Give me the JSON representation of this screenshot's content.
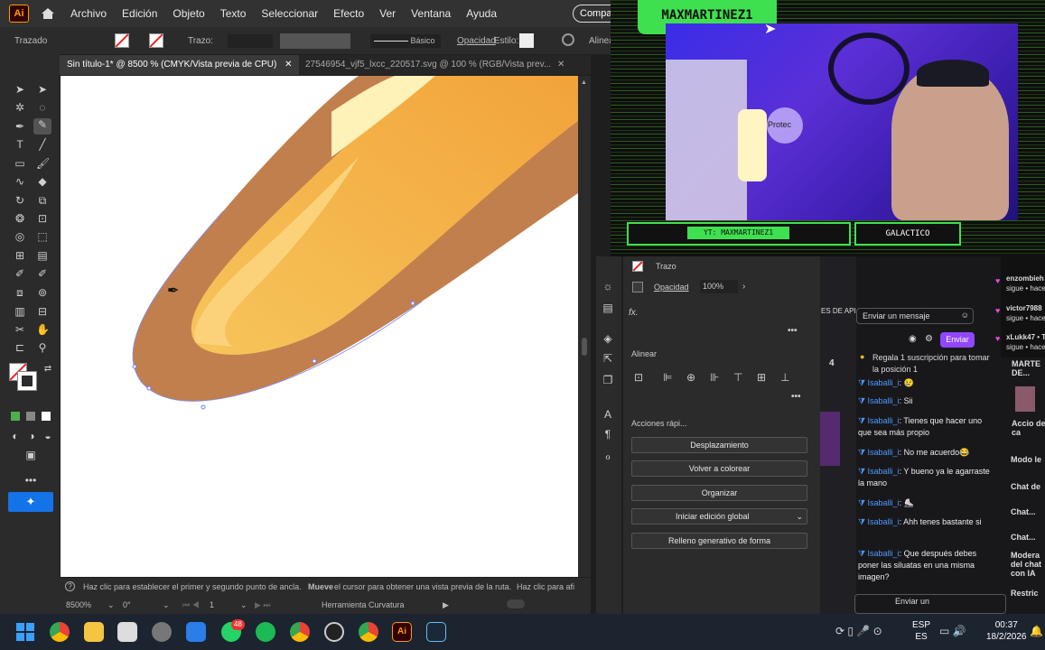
{
  "app": {
    "logo": "Ai"
  },
  "menu": [
    "Archivo",
    "Edición",
    "Objeto",
    "Texto",
    "Seleccionar",
    "Efecto",
    "Ver",
    "Ventana",
    "Ayuda"
  ],
  "share_label": "Compartir",
  "control_bar": {
    "object_label": "Trazado",
    "stroke_label": "Trazo:",
    "basic_label": "Básico",
    "opacity_label": "Opacidad",
    "style_label": "Estilo:",
    "align_label": "Alinea"
  },
  "doc_tabs": [
    {
      "label": "Sin título-1* @ 8500 % (CMYK/Vista previa de CPU)"
    },
    {
      "label": "27546954_vjf5_lxcc_220517.svg @ 100 % (RGB/Vista prev..."
    }
  ],
  "status": {
    "hint_1": "Haz clic para establecer el primer y segundo punto de ancla.",
    "hint_2_bold": "Mueve",
    "hint_2": "el cursor para obtener una vista previa de la ruta.",
    "hint_3": "Haz clic para afi",
    "zoom": "8500%",
    "angle": "0°",
    "artboard": "1",
    "tool_name": "Herramienta Curvatura"
  },
  "properties": {
    "stroke_label": "Trazo",
    "opacity_label": "Opacidad",
    "opacity_value": "100%",
    "fx": "fx.",
    "align_title": "Alinear",
    "quick_actions_title": "Acciones rápi...",
    "buttons": [
      "Desplazamiento",
      "Volver a colorear",
      "Organizar",
      "Iniciar edición global",
      "Relleno generativo de forma"
    ]
  },
  "stream": {
    "streamer": "MAXMARTINEZ1",
    "lamp_text": "Protec",
    "banner_left": "YT: MAXMARTINEZ1",
    "banner_right": "GALACTICO"
  },
  "chat": {
    "input_placeholder": "Enviar un mensaje",
    "send_label": "Enviar",
    "count": "4",
    "sub_prompt": "Regala 1 suscripción para tomar la posición 1",
    "messages": [
      {
        "user": "Isaballi_i",
        "text": "😢"
      },
      {
        "user": "Isaballi_i",
        "text": "Sii"
      },
      {
        "user": "Isaballi_i",
        "text": "Tienes que hacer uno que sea más propio"
      },
      {
        "user": "Isaballi_i",
        "text": "No me acuerdo😂"
      },
      {
        "user": "Isaballi_i",
        "text": "Y bueno ya le agarraste la mano"
      },
      {
        "user": "Isaballi_i",
        "text": "⛸️"
      },
      {
        "user": "Isaballi_i",
        "text": "Ahh tenes bastante si"
      },
      {
        "user": "Isaballi_i",
        "text": "Que después debes poner las siluatas en una misma imagen?"
      }
    ],
    "follows": [
      {
        "user": "enzombieh",
        "action": "sigue • hace"
      },
      {
        "user": "victor7988",
        "action": "sigue • hace"
      },
      {
        "user": "xLukk47 • T",
        "action": "sigue • hace"
      }
    ],
    "side_labels": [
      "MARTE DE...",
      "Accio de ca",
      "Modo le",
      "Chat de",
      "Chat...",
      "Chat...",
      "Modera del chat con IA",
      "Restric"
    ],
    "left_frag": [
      "ES DE API",
      "Enviar un"
    ]
  },
  "taskbar": {
    "lang_1": "ESP",
    "lang_2": "ES",
    "time": "00:37",
    "date": "18/2/2026",
    "badge": "48"
  }
}
